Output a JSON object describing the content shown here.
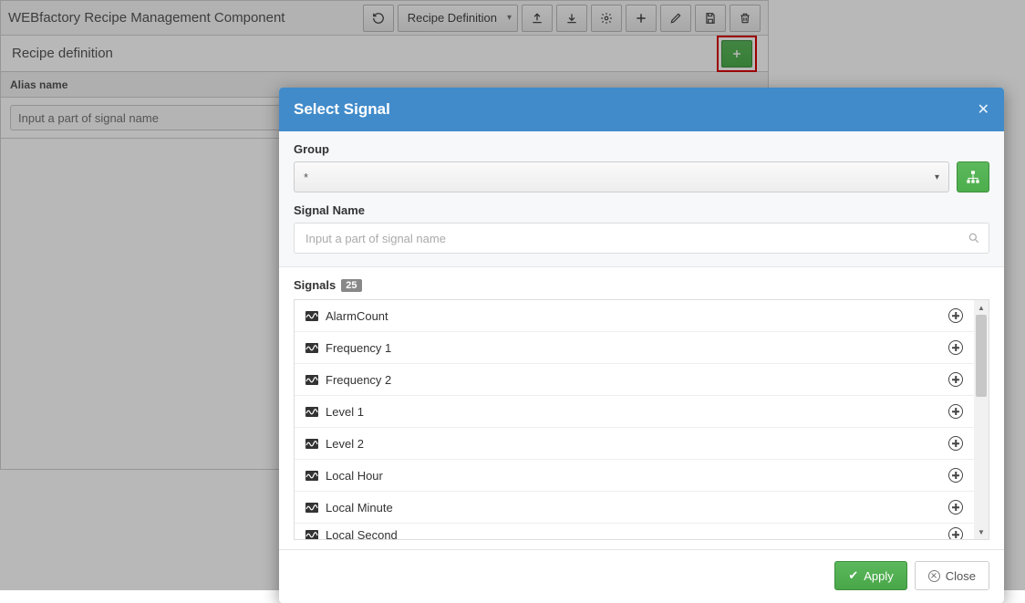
{
  "header": {
    "title": "WEBfactory Recipe Management Component",
    "mode_select": "Recipe Definition"
  },
  "panel": {
    "subtitle": "Recipe definition",
    "alias_label": "Alias name",
    "alias_placeholder": "Input a part of signal name"
  },
  "modal": {
    "title": "Select Signal",
    "group_label": "Group",
    "group_value": "*",
    "signal_name_label": "Signal Name",
    "signal_name_placeholder": "Input a part of signal name",
    "signals_label": "Signals",
    "signals_count": "25",
    "signals": [
      "AlarmCount",
      "Frequency 1",
      "Frequency 2",
      "Level 1",
      "Level 2",
      "Local Hour",
      "Local Minute",
      "Local Second"
    ],
    "apply_label": "Apply",
    "close_label": "Close"
  }
}
